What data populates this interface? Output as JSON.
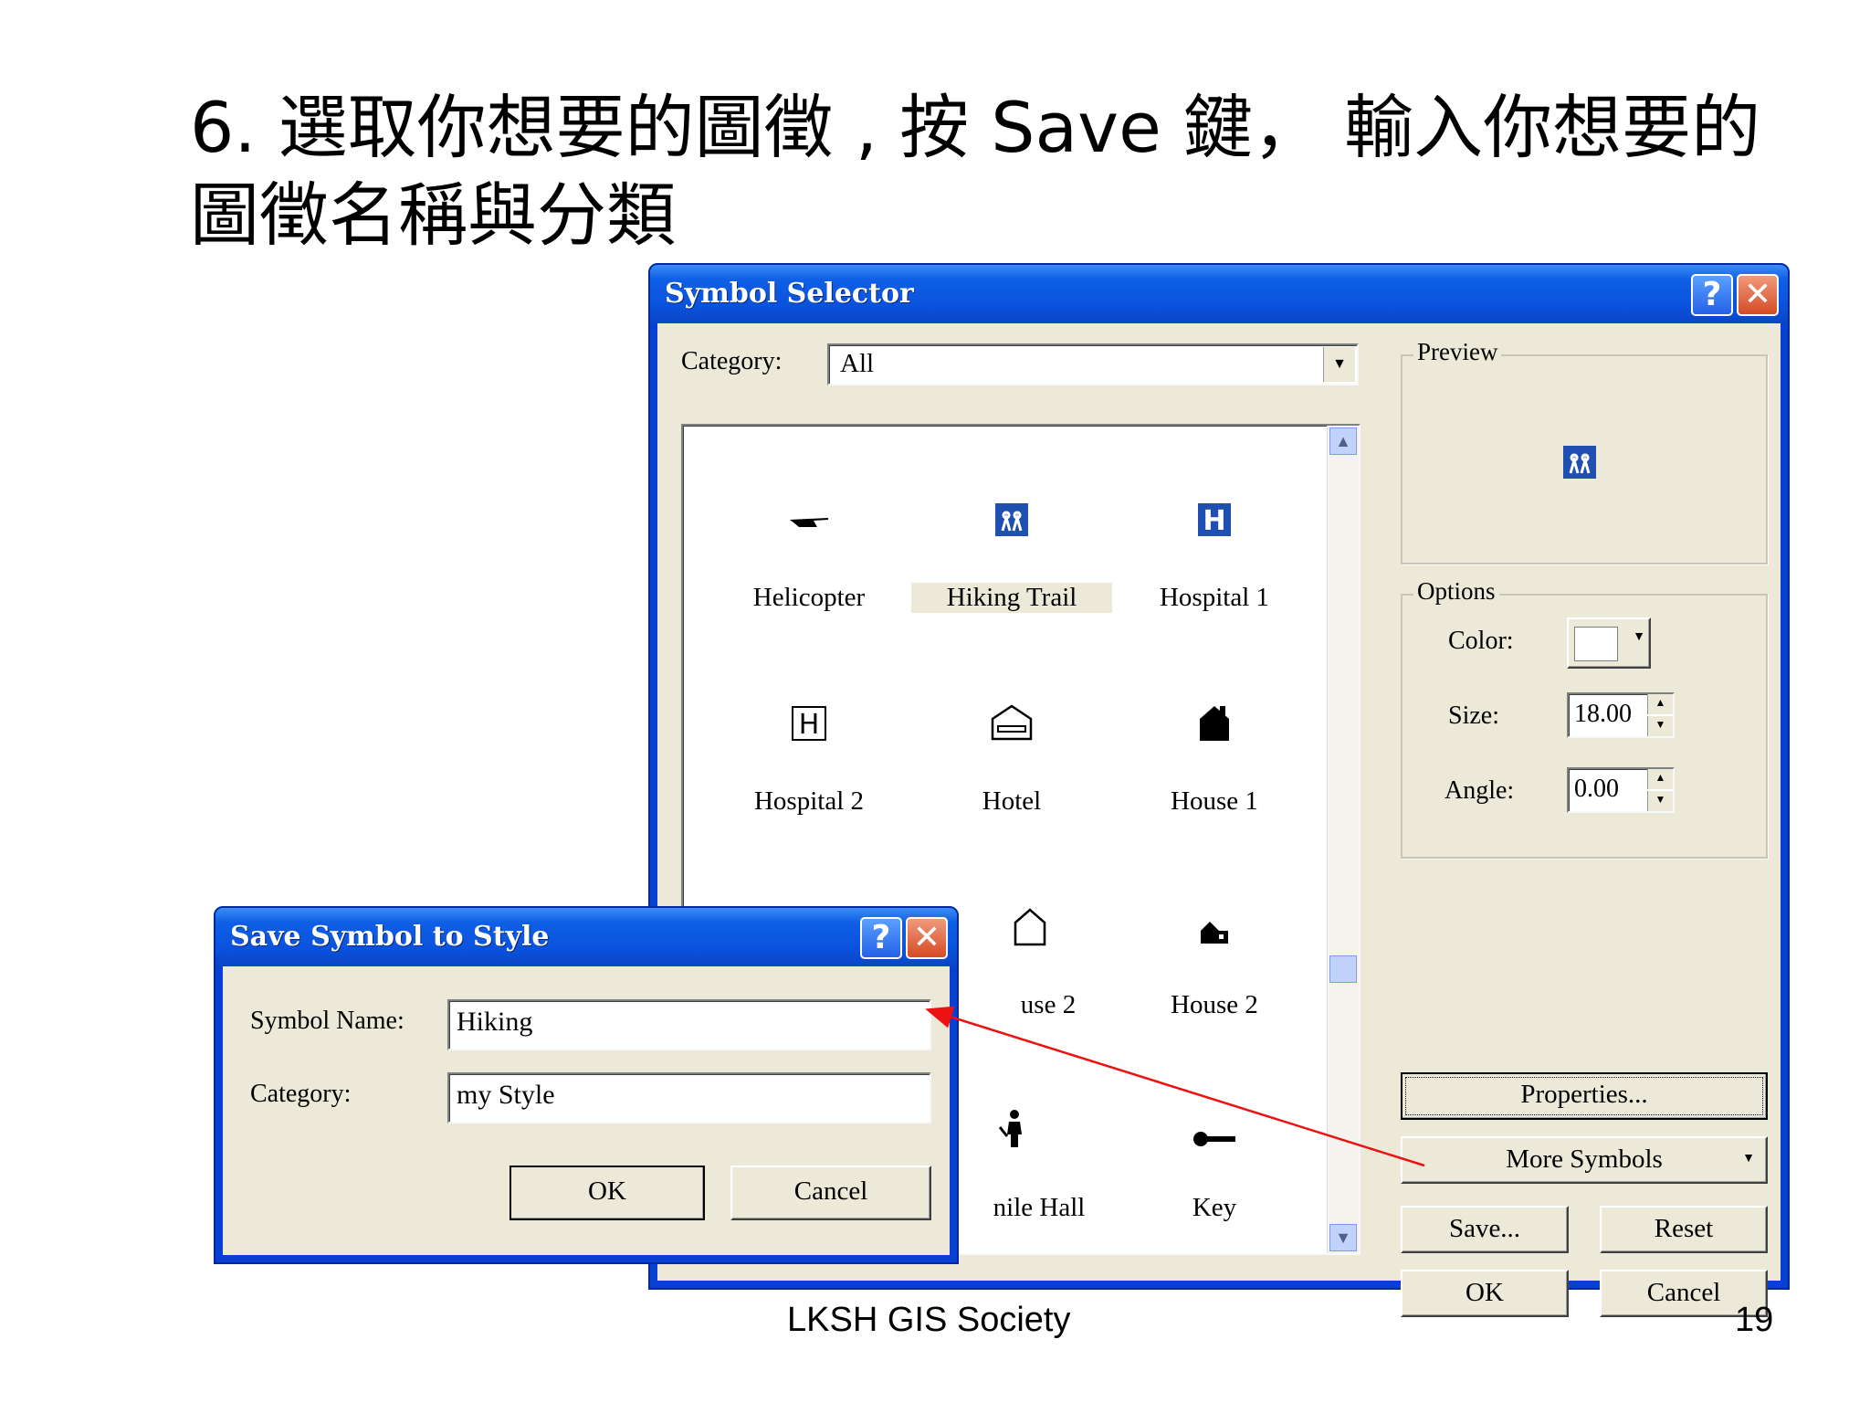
{
  "slide": {
    "title_line1": "6. 選取你想要的圖徵 , 按 Save 鍵， 輸入你想要的",
    "title_line2": "圖徵名稱與分類",
    "footer_center": "LKSH  GIS Society",
    "page_number": "19"
  },
  "symbol_selector": {
    "title": "Symbol Selector",
    "help_btn": "?",
    "close_btn": "✕",
    "category_label": "Category:",
    "category_value": "All",
    "symbols": [
      {
        "label": "Helicopter",
        "icon": "helicopter-icon",
        "glyph": "✈"
      },
      {
        "label": "Hiking Trail",
        "icon": "hiking-trail-icon",
        "glyph": "👥"
      },
      {
        "label": "Hospital 1",
        "icon": "hospital-1-icon",
        "glyph": "H"
      },
      {
        "label": "Hospital 2",
        "icon": "hospital-2-icon",
        "glyph": "H"
      },
      {
        "label": "Hotel",
        "icon": "hotel-icon",
        "glyph": "⌂"
      },
      {
        "label": "House 1",
        "icon": "house-1-icon",
        "glyph": "⌂"
      },
      {
        "label": "use 2",
        "icon": "house-outline-icon",
        "glyph": "⌂"
      },
      {
        "label": "House 2",
        "icon": "house-2-icon",
        "glyph": "⌂"
      },
      {
        "label": "nile Hall",
        "icon": "juvenile-hall-icon",
        "glyph": "🚶"
      },
      {
        "label": "Key",
        "icon": "key-icon",
        "glyph": "⊸"
      }
    ],
    "preview_label": "Preview",
    "options_label": "Options",
    "color_label": "Color:",
    "size_label": "Size:",
    "size_value": "18.00",
    "angle_label": "Angle:",
    "angle_value": "0.00",
    "properties_btn": "Properties...",
    "more_symbols_btn": "More Symbols",
    "save_btn": "Save...",
    "reset_btn": "Reset",
    "ok_btn": "OK",
    "cancel_btn": "Cancel"
  },
  "save_dialog": {
    "title": "Save Symbol to Style",
    "help_btn": "?",
    "close_btn": "✕",
    "name_label": "Symbol Name:",
    "name_value": "Hiking",
    "category_label": "Category:",
    "category_value": "my Style",
    "ok_btn": "OK",
    "cancel_btn": "Cancel"
  },
  "colors": {
    "xp_title_blue": "#0a52dd",
    "dialog_face": "#ece9d8",
    "hiking_icon_blue": "#1f4fb0",
    "arrow_red": "#ee1111"
  }
}
